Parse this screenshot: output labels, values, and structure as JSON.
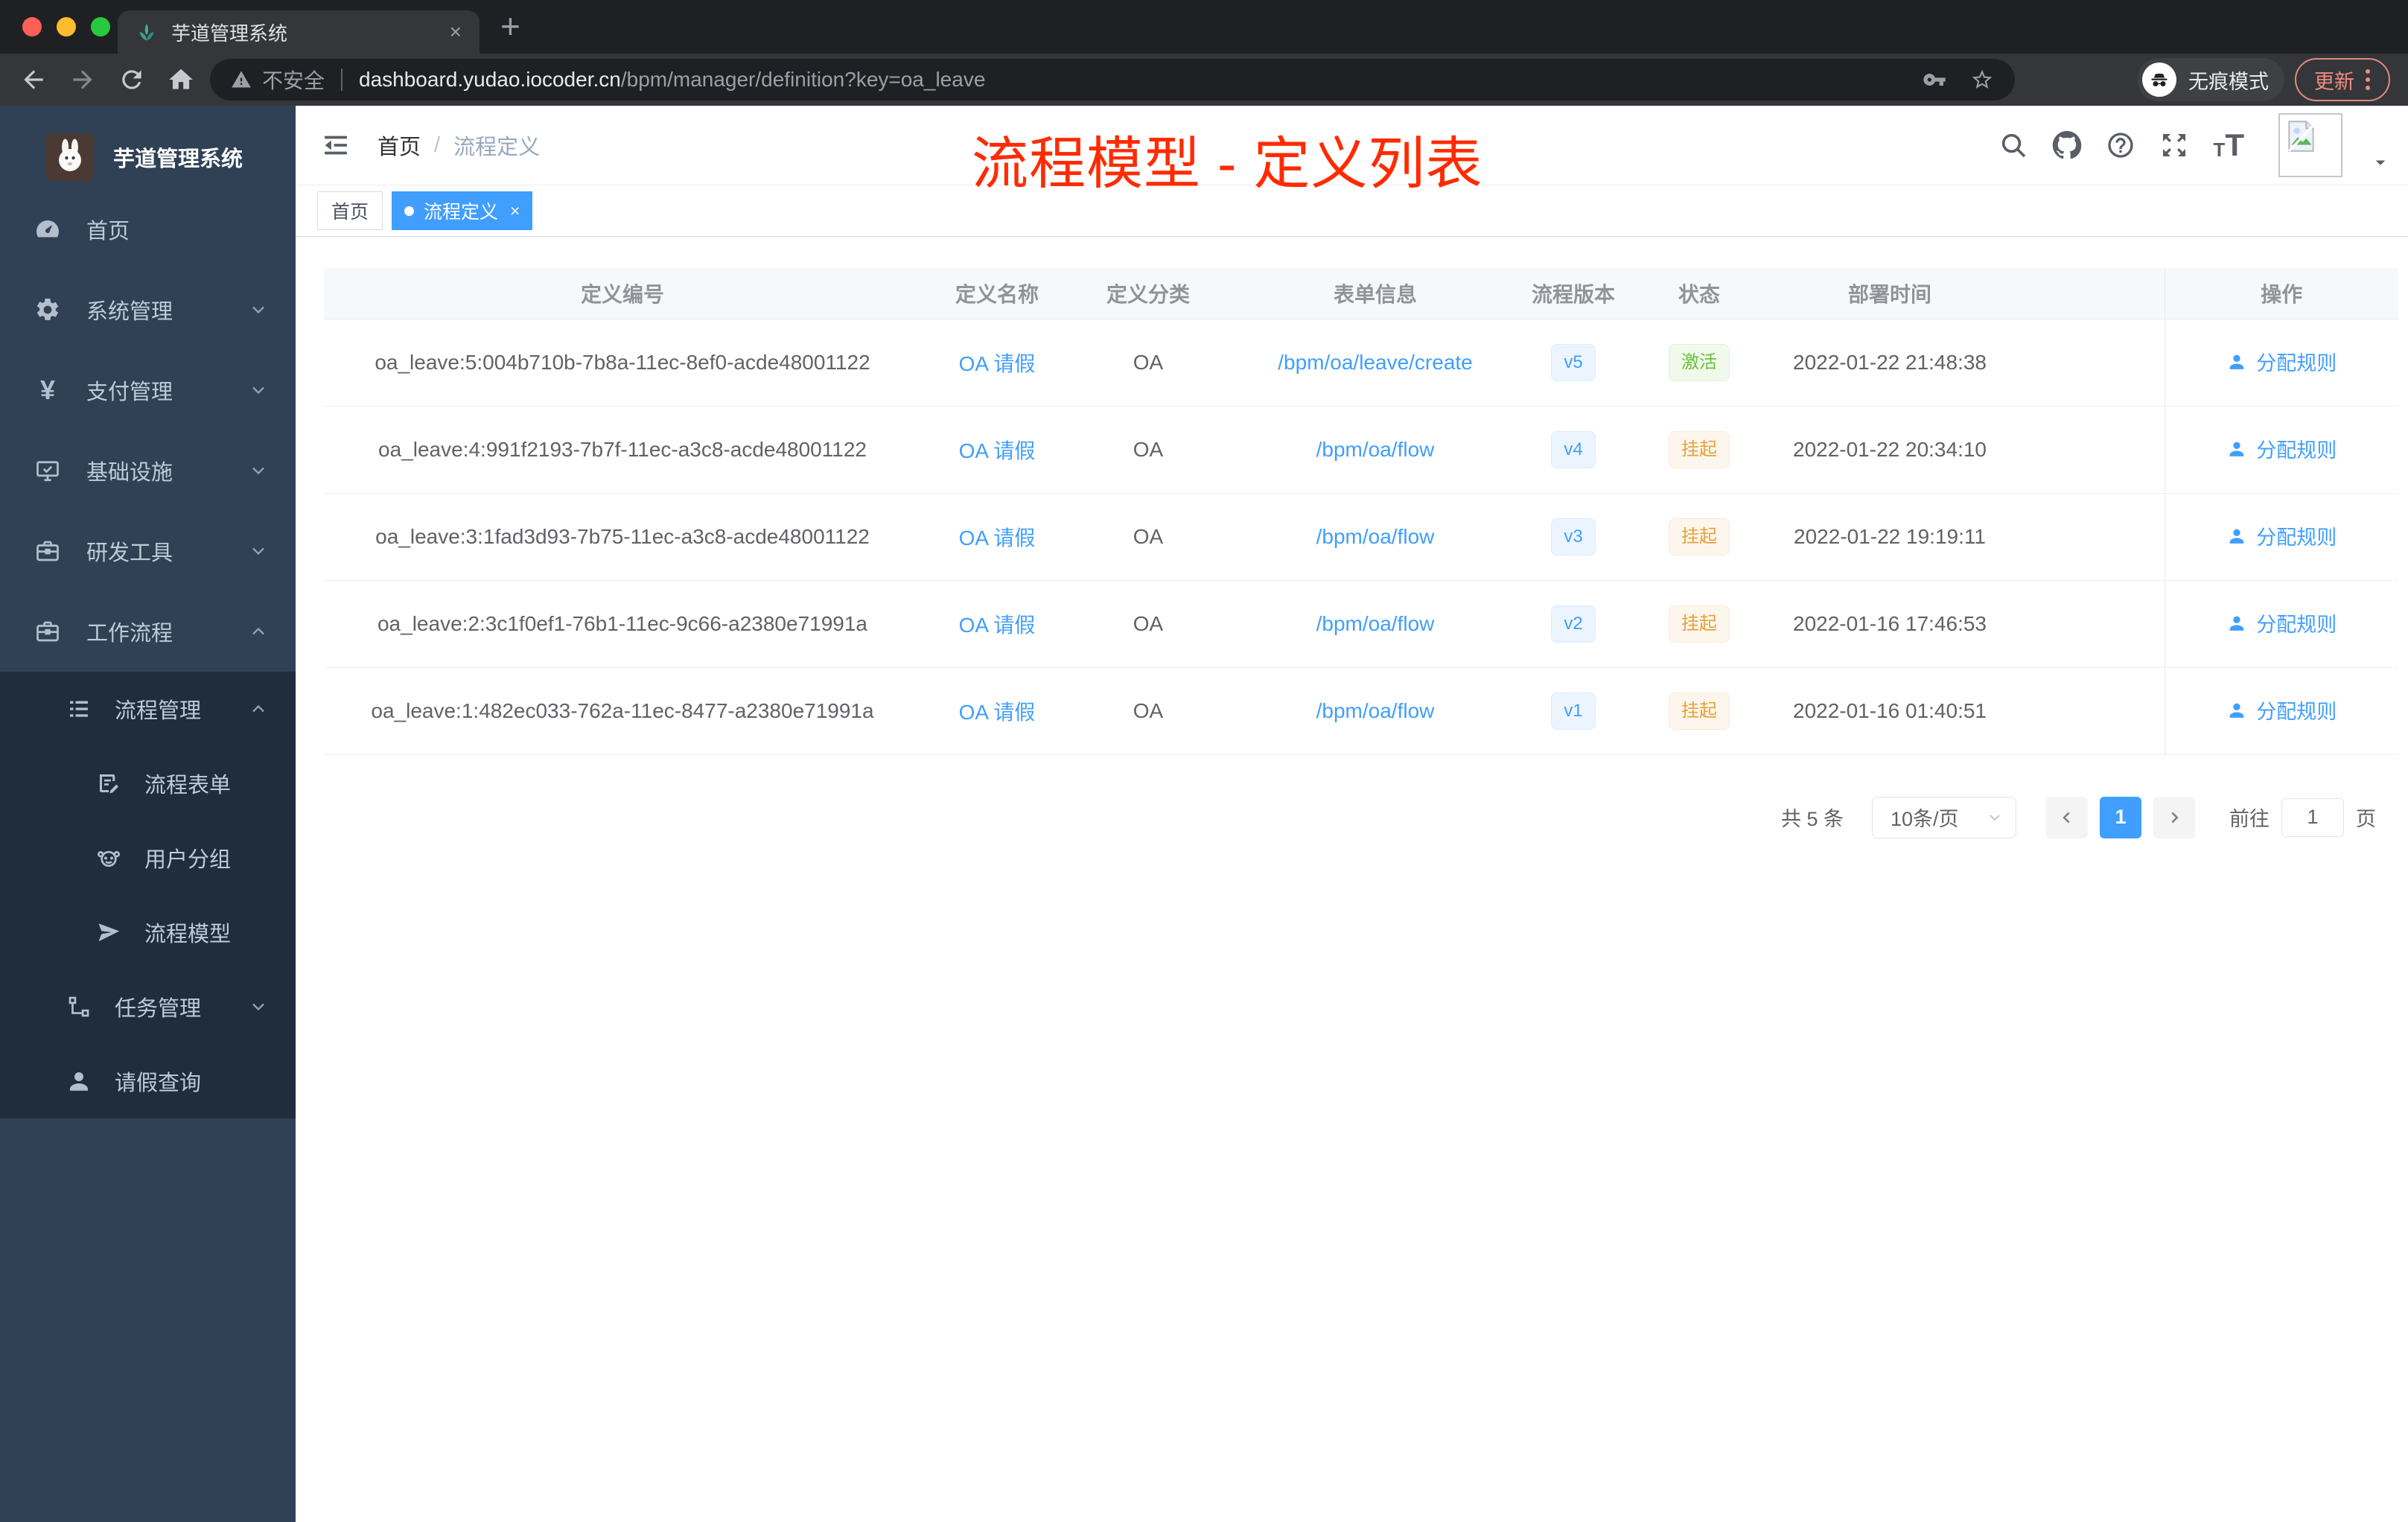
{
  "colors": {
    "accent": "#409eff",
    "success": "#67c23a",
    "warning": "#e6a23c",
    "title": "#ff2b00",
    "update": "#f28b82"
  },
  "glyphs": {
    "close": "×",
    "add": "+"
  },
  "browser": {
    "tab_title": "芋道管理系统",
    "security_label": "不安全",
    "url_host": "dashboard.yudao.iocoder.cn",
    "url_path": "/bpm/manager/definition?key=oa_leave",
    "incognito_label": "无痕模式",
    "update_label": "更新"
  },
  "sidebar": {
    "logo_title": "芋道管理系统",
    "items": [
      {
        "label": "首页"
      },
      {
        "label": "系统管理"
      },
      {
        "label": "支付管理"
      },
      {
        "label": "基础设施"
      },
      {
        "label": "研发工具"
      },
      {
        "label": "工作流程"
      },
      {
        "label": "流程管理"
      },
      {
        "label": "流程表单"
      },
      {
        "label": "用户分组"
      },
      {
        "label": "流程模型"
      },
      {
        "label": "任务管理"
      },
      {
        "label": "请假查询"
      }
    ]
  },
  "header": {
    "breadcrumb": {
      "root": "首页",
      "current": "流程定义"
    },
    "overlay_title": "流程模型 - 定义列表"
  },
  "tags": {
    "home": "首页",
    "active": "流程定义"
  },
  "table": {
    "columns": [
      "定义编号",
      "定义名称",
      "定义分类",
      "表单信息",
      "流程版本",
      "状态",
      "部署时间",
      "操作"
    ],
    "rows": [
      {
        "id": "oa_leave:5:004b710b-7b8a-11ec-8ef0-acde48001122",
        "name": "OA 请假",
        "category": "OA",
        "form": "/bpm/oa/leave/create",
        "version": "v5",
        "status": "激活",
        "status_class": "badge-success",
        "deploy_time": "2022-01-22 21:48:38",
        "action": "分配规则"
      },
      {
        "id": "oa_leave:4:991f2193-7b7f-11ec-a3c8-acde48001122",
        "name": "OA 请假",
        "category": "OA",
        "form": "/bpm/oa/flow",
        "version": "v4",
        "status": "挂起",
        "status_class": "badge-warning",
        "deploy_time": "2022-01-22 20:34:10",
        "action": "分配规则"
      },
      {
        "id": "oa_leave:3:1fad3d93-7b75-11ec-a3c8-acde48001122",
        "name": "OA 请假",
        "category": "OA",
        "form": "/bpm/oa/flow",
        "version": "v3",
        "status": "挂起",
        "status_class": "badge-warning",
        "deploy_time": "2022-01-22 19:19:11",
        "action": "分配规则"
      },
      {
        "id": "oa_leave:2:3c1f0ef1-76b1-11ec-9c66-a2380e71991a",
        "name": "OA 请假",
        "category": "OA",
        "form": "/bpm/oa/flow",
        "version": "v2",
        "status": "挂起",
        "status_class": "badge-warning",
        "deploy_time": "2022-01-16 17:46:53",
        "action": "分配规则"
      },
      {
        "id": "oa_leave:1:482ec033-762a-11ec-8477-a2380e71991a",
        "name": "OA 请假",
        "category": "OA",
        "form": "/bpm/oa/flow",
        "version": "v1",
        "status": "挂起",
        "status_class": "badge-warning",
        "deploy_time": "2022-01-16 01:40:51",
        "action": "分配规则"
      }
    ]
  },
  "pagination": {
    "total": "共 5 条",
    "page_size": "10条/页",
    "current_page": "1",
    "goto_label": "前往",
    "goto_value": "1",
    "unit_label": "页"
  }
}
